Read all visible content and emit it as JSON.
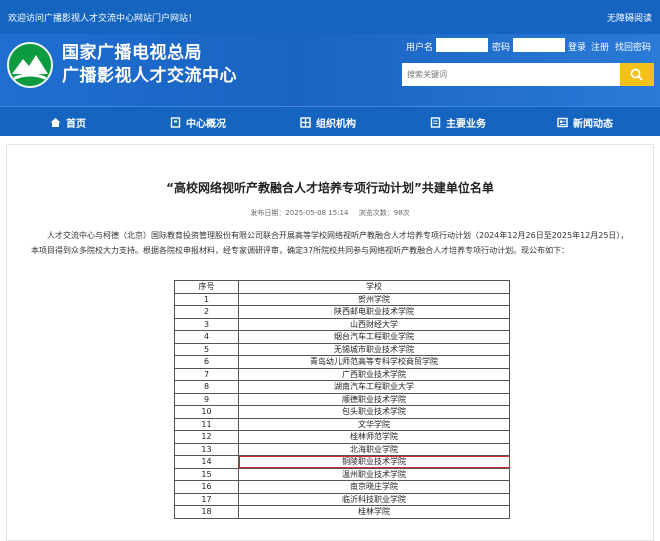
{
  "topbar": {
    "welcome": "欢迎访问广播影视人才交流中心网站门户网站！",
    "accessible": "无障碍阅读"
  },
  "header": {
    "title": "国家广播电视总局",
    "subtitle": "广播影视人才交流中心",
    "logo_icon": "green-mountain-logo"
  },
  "login": {
    "user_label": "用户名",
    "password_label": "密码",
    "login_link": "登录",
    "register_link": "注册",
    "forgot_link": "找回密码"
  },
  "search": {
    "placeholder": "搜索关键词",
    "button_icon": "search-icon"
  },
  "nav": {
    "items": [
      {
        "label": "首页",
        "icon": "home-icon"
      },
      {
        "label": "中心概况",
        "icon": "building-icon"
      },
      {
        "label": "组织机构",
        "icon": "org-icon"
      },
      {
        "label": "主要业务",
        "icon": "document-icon"
      },
      {
        "label": "新闻动态",
        "icon": "news-icon"
      }
    ]
  },
  "article": {
    "title": "“高校网络视听产教融合人才培养专项行动计划”共建单位名单",
    "published": "发布日期：2025-05-08 15:14",
    "views": "浏览次数：98次",
    "body": "人才交流中心与柯德（北京）国际教育投资管理股份有限公司联合开展高等学校网络视听产教融合人才培养专项行动计划（2024年12月26日至2025年12月25日），本项目得到众多院校大力支持。根据各院校申报材料，经专家调研评审，确定37所院校共同参与网络视听产教融合人才培养专项行动计划。现公布如下："
  },
  "table": {
    "headers": [
      "序号",
      "学校"
    ],
    "rows": [
      [
        "1",
        "贺州学院"
      ],
      [
        "2",
        "陕西邮电职业技术学院"
      ],
      [
        "3",
        "山西财经大学"
      ],
      [
        "4",
        "烟台汽车工程职业学院"
      ],
      [
        "5",
        "无锡城市职业技术学院"
      ],
      [
        "6",
        "青岛幼儿师范高等专科学校商贸学院"
      ],
      [
        "7",
        "广西职业技术学院"
      ],
      [
        "8",
        "湖南汽车工程职业大学"
      ],
      [
        "9",
        "顺德职业技术学院"
      ],
      [
        "10",
        "包头职业技术学院"
      ],
      [
        "11",
        "文华学院"
      ],
      [
        "12",
        "桂林师范学院"
      ],
      [
        "13",
        "北海职业学院"
      ],
      [
        "14",
        "铜陵职业技术学院"
      ],
      [
        "15",
        "温州职业技术学院"
      ],
      [
        "16",
        "南京晓庄学院"
      ],
      [
        "17",
        "临沂科技职业学院"
      ],
      [
        "18",
        "桂林学院"
      ]
    ],
    "highlighted_row": 14,
    "highlight_color": "#d9262b"
  },
  "colors": {
    "brand_blue": "#1565c0",
    "search_button": "#f2c21a",
    "logo_green": "#0e9a3e"
  }
}
